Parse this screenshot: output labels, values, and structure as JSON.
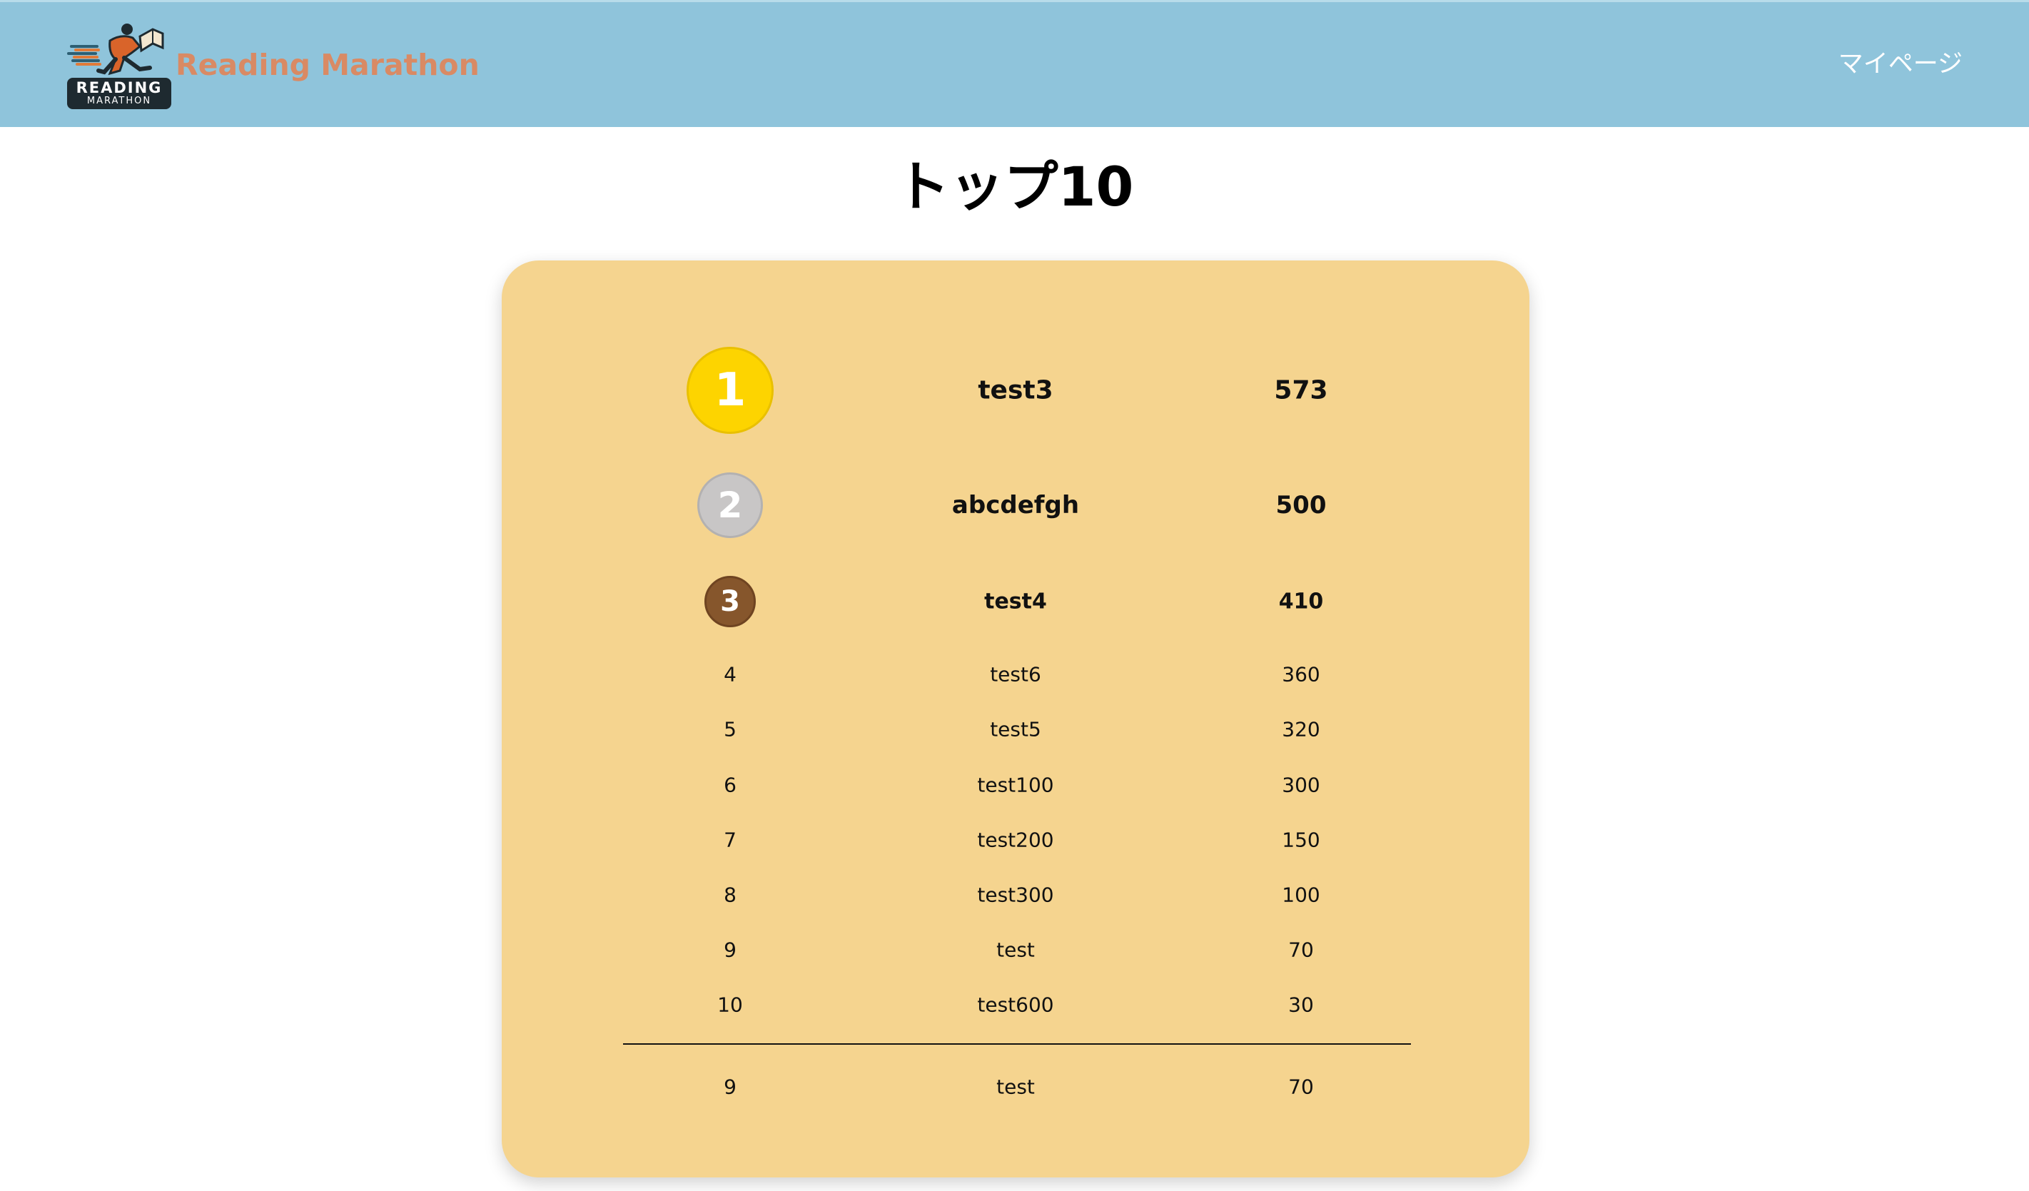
{
  "header": {
    "brand": "Reading Marathon",
    "logo_text": "READING",
    "logo_subtext": "MARATHON",
    "mypage_label": "マイページ",
    "background": "#8fc4db",
    "brand_color": "#d98a64"
  },
  "page": {
    "title": "トップ10"
  },
  "ranking": {
    "background": "#f5d48f",
    "medal_colors": {
      "gold": "#fdd400",
      "silver": "#c8c6c6",
      "bronze": "#86562c"
    },
    "rows": [
      {
        "rank": "1",
        "name": "test3",
        "score": "573"
      },
      {
        "rank": "2",
        "name": "abcdefgh",
        "score": "500"
      },
      {
        "rank": "3",
        "name": "test4",
        "score": "410"
      },
      {
        "rank": "4",
        "name": "test6",
        "score": "360"
      },
      {
        "rank": "5",
        "name": "test5",
        "score": "320"
      },
      {
        "rank": "6",
        "name": "test100",
        "score": "300"
      },
      {
        "rank": "7",
        "name": "test200",
        "score": "150"
      },
      {
        "rank": "8",
        "name": "test300",
        "score": "100"
      },
      {
        "rank": "9",
        "name": "test",
        "score": "70"
      },
      {
        "rank": "10",
        "name": "test600",
        "score": "30"
      }
    ],
    "my_rank": {
      "rank": "9",
      "name": "test",
      "score": "70"
    }
  }
}
